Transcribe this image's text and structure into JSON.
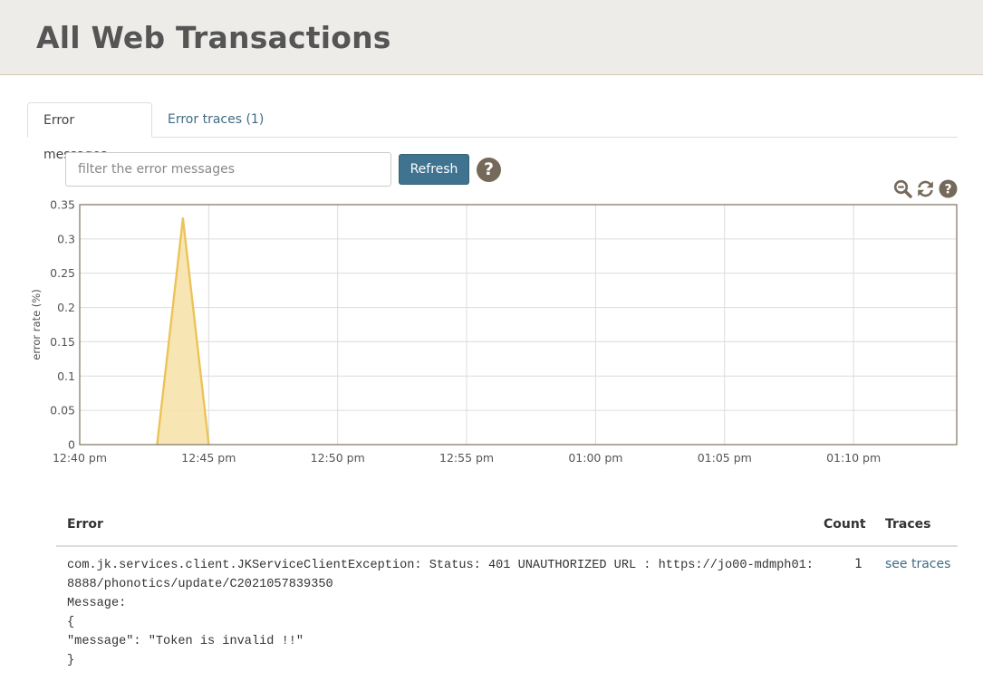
{
  "page": {
    "title": "All Web Transactions"
  },
  "tabs": [
    {
      "label": "Error messages",
      "active": true
    },
    {
      "label": "Error traces (1)",
      "active": false
    }
  ],
  "filter": {
    "placeholder": "filter the error messages",
    "value": ""
  },
  "refresh_label": "Refresh",
  "help_icon": "question-circle-icon",
  "chart_tools": [
    "zoom-out-icon",
    "refresh-icon",
    "question-circle-icon"
  ],
  "colors": {
    "accent": "#3f7390",
    "link": "#3f6b85",
    "series_fill": "#f6e3ac",
    "series_stroke": "#ecc359",
    "header_bg": "#eeece9",
    "help_icon": "#75695a"
  },
  "chart_data": {
    "type": "area",
    "xlabel": "",
    "ylabel": "error rate (%)",
    "x_ticks": [
      "12:40 pm",
      "12:45 pm",
      "12:50 pm",
      "12:55 pm",
      "01:00 pm",
      "01:05 pm",
      "01:10 pm"
    ],
    "y_ticks": [
      "0",
      "0.05",
      "0.1",
      "0.15",
      "0.2",
      "0.25",
      "0.3",
      "0.35"
    ],
    "ylim": [
      0,
      0.35
    ],
    "xlim": [
      "12:40 pm",
      "01:14 pm"
    ],
    "grid": true,
    "series": [
      {
        "values": [
          {
            "x": "12:43 pm",
            "y": 0
          },
          {
            "x": "12:44 pm",
            "y": 0.33
          },
          {
            "x": "12:45 pm",
            "y": 0
          }
        ]
      }
    ]
  },
  "table": {
    "headers": {
      "error": "Error",
      "count": "Count",
      "traces": "Traces"
    },
    "rows": [
      {
        "error": "com.jk.services.client.JKServiceClientException: Status: 401 UNAUTHORIZED URL : https://jo00-mdmph01:8888/phonotics/update/C2021057839350\nMessage:\n{\n\"message\": \"Token is invalid !!\"\n}",
        "count": "1",
        "traces_link": "see traces"
      }
    ]
  }
}
